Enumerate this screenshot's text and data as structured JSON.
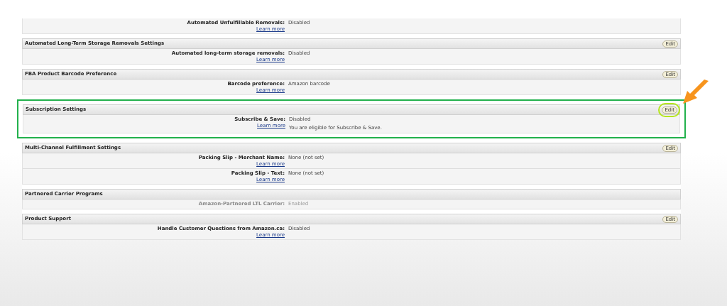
{
  "sections": [
    {
      "highlighted": false,
      "rows": [
        {
          "label": "Automated Unfulfillable Removals:",
          "value": "Disabled",
          "link": "Learn more",
          "disabled": false
        }
      ]
    },
    {
      "title": "Automated Long-Term Storage Removals Settings",
      "edit": {
        "label": "Edit",
        "circled": false
      },
      "highlighted": false,
      "rows": [
        {
          "label": "Automated long-term storage removals:",
          "value": "Disabled",
          "link": "Learn more",
          "disabled": false
        }
      ]
    },
    {
      "title": "FBA Product Barcode Preference",
      "edit": {
        "label": "Edit",
        "circled": false
      },
      "highlighted": false,
      "rows": [
        {
          "label": "Barcode preference:",
          "value": "Amazon barcode",
          "link": "Learn more",
          "disabled": false
        }
      ]
    },
    {
      "title": "Subscription Settings",
      "edit": {
        "label": "Edit",
        "circled": true
      },
      "highlighted": true,
      "rows": [
        {
          "label": "Subscribe & Save:",
          "value": "Disabled",
          "note": "You are eligible for Subscribe & Save.",
          "link": "Learn more",
          "disabled": false
        }
      ]
    },
    {
      "title": "Multi-Channel Fulfillment Settings",
      "edit": {
        "label": "Edit",
        "circled": false
      },
      "highlighted": false,
      "rows": [
        {
          "label": "Packing Slip - Merchant Name:",
          "value": "None (not set)",
          "link": "Learn more",
          "disabled": false
        },
        {
          "label": "Packing Slip - Text:",
          "value": "None (not set)",
          "link": "Learn more",
          "disabled": false
        }
      ]
    },
    {
      "title": "Partnered Carrier Programs",
      "highlighted": false,
      "rows": [
        {
          "label": "Amazon-Partnered LTL Carrier:",
          "value": "Enabled",
          "disabled": true
        }
      ]
    },
    {
      "title": "Product Support",
      "edit": {
        "label": "Edit",
        "circled": false
      },
      "highlighted": false,
      "rows": [
        {
          "label": "Handle Customer Questions from Amazon.ca:",
          "value": "Disabled",
          "link": "Learn more",
          "disabled": false
        }
      ]
    }
  ]
}
